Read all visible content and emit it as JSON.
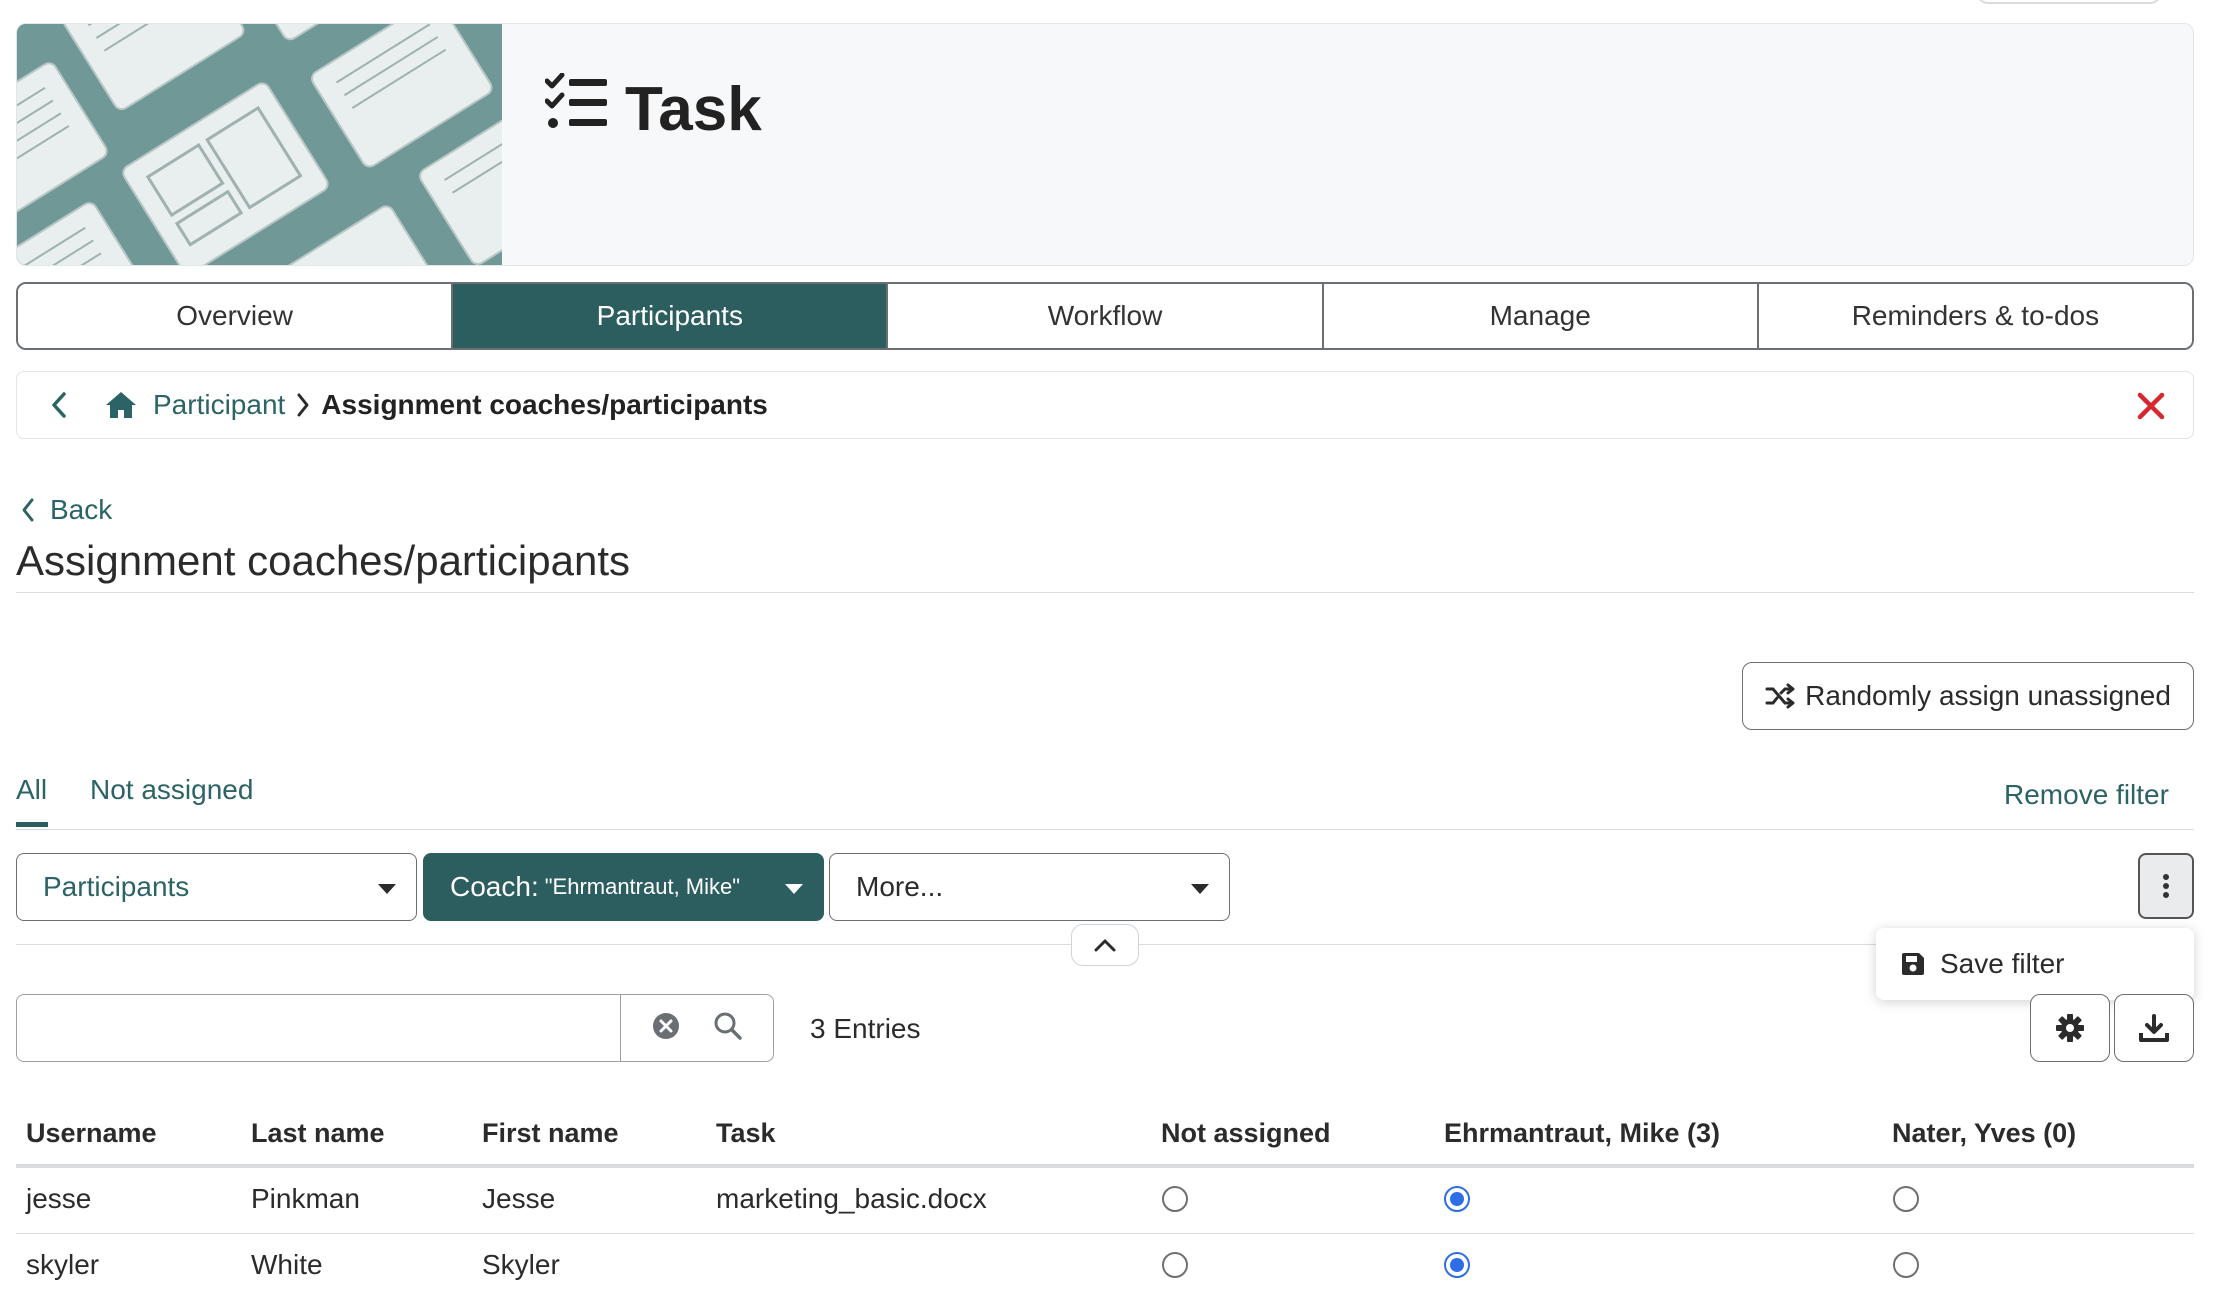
{
  "header": {
    "title": "Task"
  },
  "tabs": [
    {
      "label": "Overview",
      "active": false
    },
    {
      "label": "Participants",
      "active": true
    },
    {
      "label": "Workflow",
      "active": false
    },
    {
      "label": "Manage",
      "active": false
    },
    {
      "label": "Reminders & to-dos",
      "active": false
    }
  ],
  "breadcrumb": {
    "link": "Participant",
    "current": "Assignment coaches/participants"
  },
  "page": {
    "back_label": "Back",
    "title": "Assignment coaches/participants"
  },
  "actions": {
    "random_assign_label": "Randomly assign unassigned"
  },
  "filter_tabs": {
    "all": "All",
    "not_assigned": "Not assigned",
    "remove_filter": "Remove filter"
  },
  "filters": {
    "participants": "Participants",
    "coach_label": "Coach:",
    "coach_value": "\"Ehrmantraut, Mike\"",
    "more": "More..."
  },
  "popup": {
    "save_filter": "Save filter"
  },
  "search": {
    "placeholder": "",
    "entries": "3 Entries"
  },
  "table": {
    "headers": [
      "Username",
      "Last name",
      "First name",
      "Task",
      "Not assigned",
      "Ehrmantraut, Mike (3)",
      "Nater, Yves (0)"
    ],
    "rows": [
      {
        "username": "jesse",
        "last_name": "Pinkman",
        "first_name": "Jesse",
        "task": "marketing_basic.docx",
        "selected": "Ehrmantraut, Mike"
      },
      {
        "username": "skyler",
        "last_name": "White",
        "first_name": "Skyler",
        "task": "",
        "selected": "Ehrmantraut, Mike"
      }
    ]
  },
  "colors": {
    "accent": "#2c5e60",
    "link": "#2c6366",
    "radio": "#2f6ce8",
    "close": "#d8262e"
  }
}
